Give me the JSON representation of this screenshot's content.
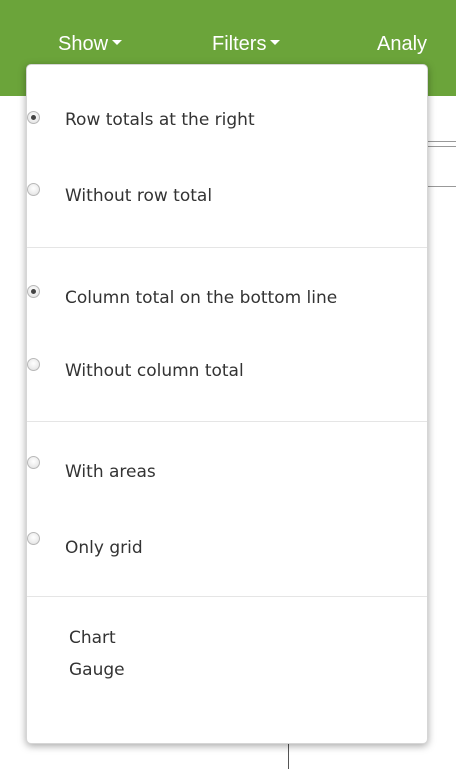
{
  "menubar": {
    "items": [
      {
        "label": "Show"
      },
      {
        "label": "Filters"
      },
      {
        "label": "Analy"
      }
    ],
    "color": "#6ba43a"
  },
  "dropdown": {
    "groups": [
      {
        "options": [
          {
            "label": "Row totals at the right",
            "checked": true
          },
          {
            "label": "Without row total",
            "checked": false
          }
        ]
      },
      {
        "options": [
          {
            "label": "Column total on the bottom line",
            "checked": true
          },
          {
            "label": "Without column total",
            "checked": false
          }
        ]
      },
      {
        "options": [
          {
            "label": "With areas",
            "checked": false
          },
          {
            "label": "Only grid",
            "checked": false
          }
        ]
      }
    ],
    "links": [
      {
        "label": "Chart"
      },
      {
        "label": "Gauge"
      }
    ]
  }
}
